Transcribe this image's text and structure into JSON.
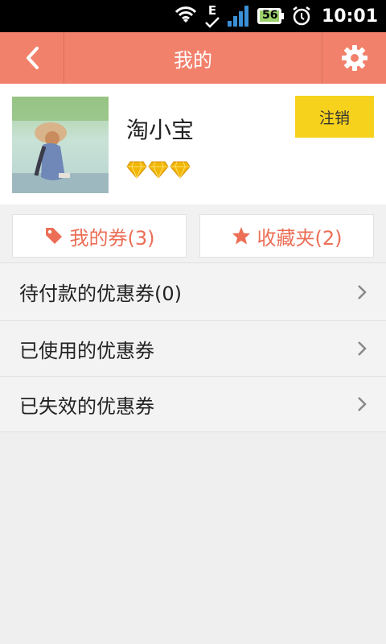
{
  "status_bar": {
    "network_letter": "E",
    "battery_level": "56",
    "time": "10:01"
  },
  "nav": {
    "title": "我的"
  },
  "profile": {
    "username": "淘小宝",
    "gem_count": 3,
    "logout_label": "注销"
  },
  "quick_actions": {
    "coupons_label": "我的券(3)",
    "favorites_label": "收藏夹(2)"
  },
  "list": {
    "items": [
      {
        "label": "待付款的优惠券(0)"
      },
      {
        "label": "已使用的优惠券"
      },
      {
        "label": "已失效的优惠券"
      }
    ]
  },
  "colors": {
    "nav_bg": "#f2816c",
    "accent": "#ec6e56",
    "logout_bg": "#f7d21c",
    "gem": "#f2b705"
  },
  "icons": {
    "back": "chevron-left-icon",
    "settings": "gear-icon",
    "coupons": "tag-icon",
    "favorites": "star-icon",
    "row_arrow": "chevron-right-icon",
    "gem": "diamond-icon"
  }
}
